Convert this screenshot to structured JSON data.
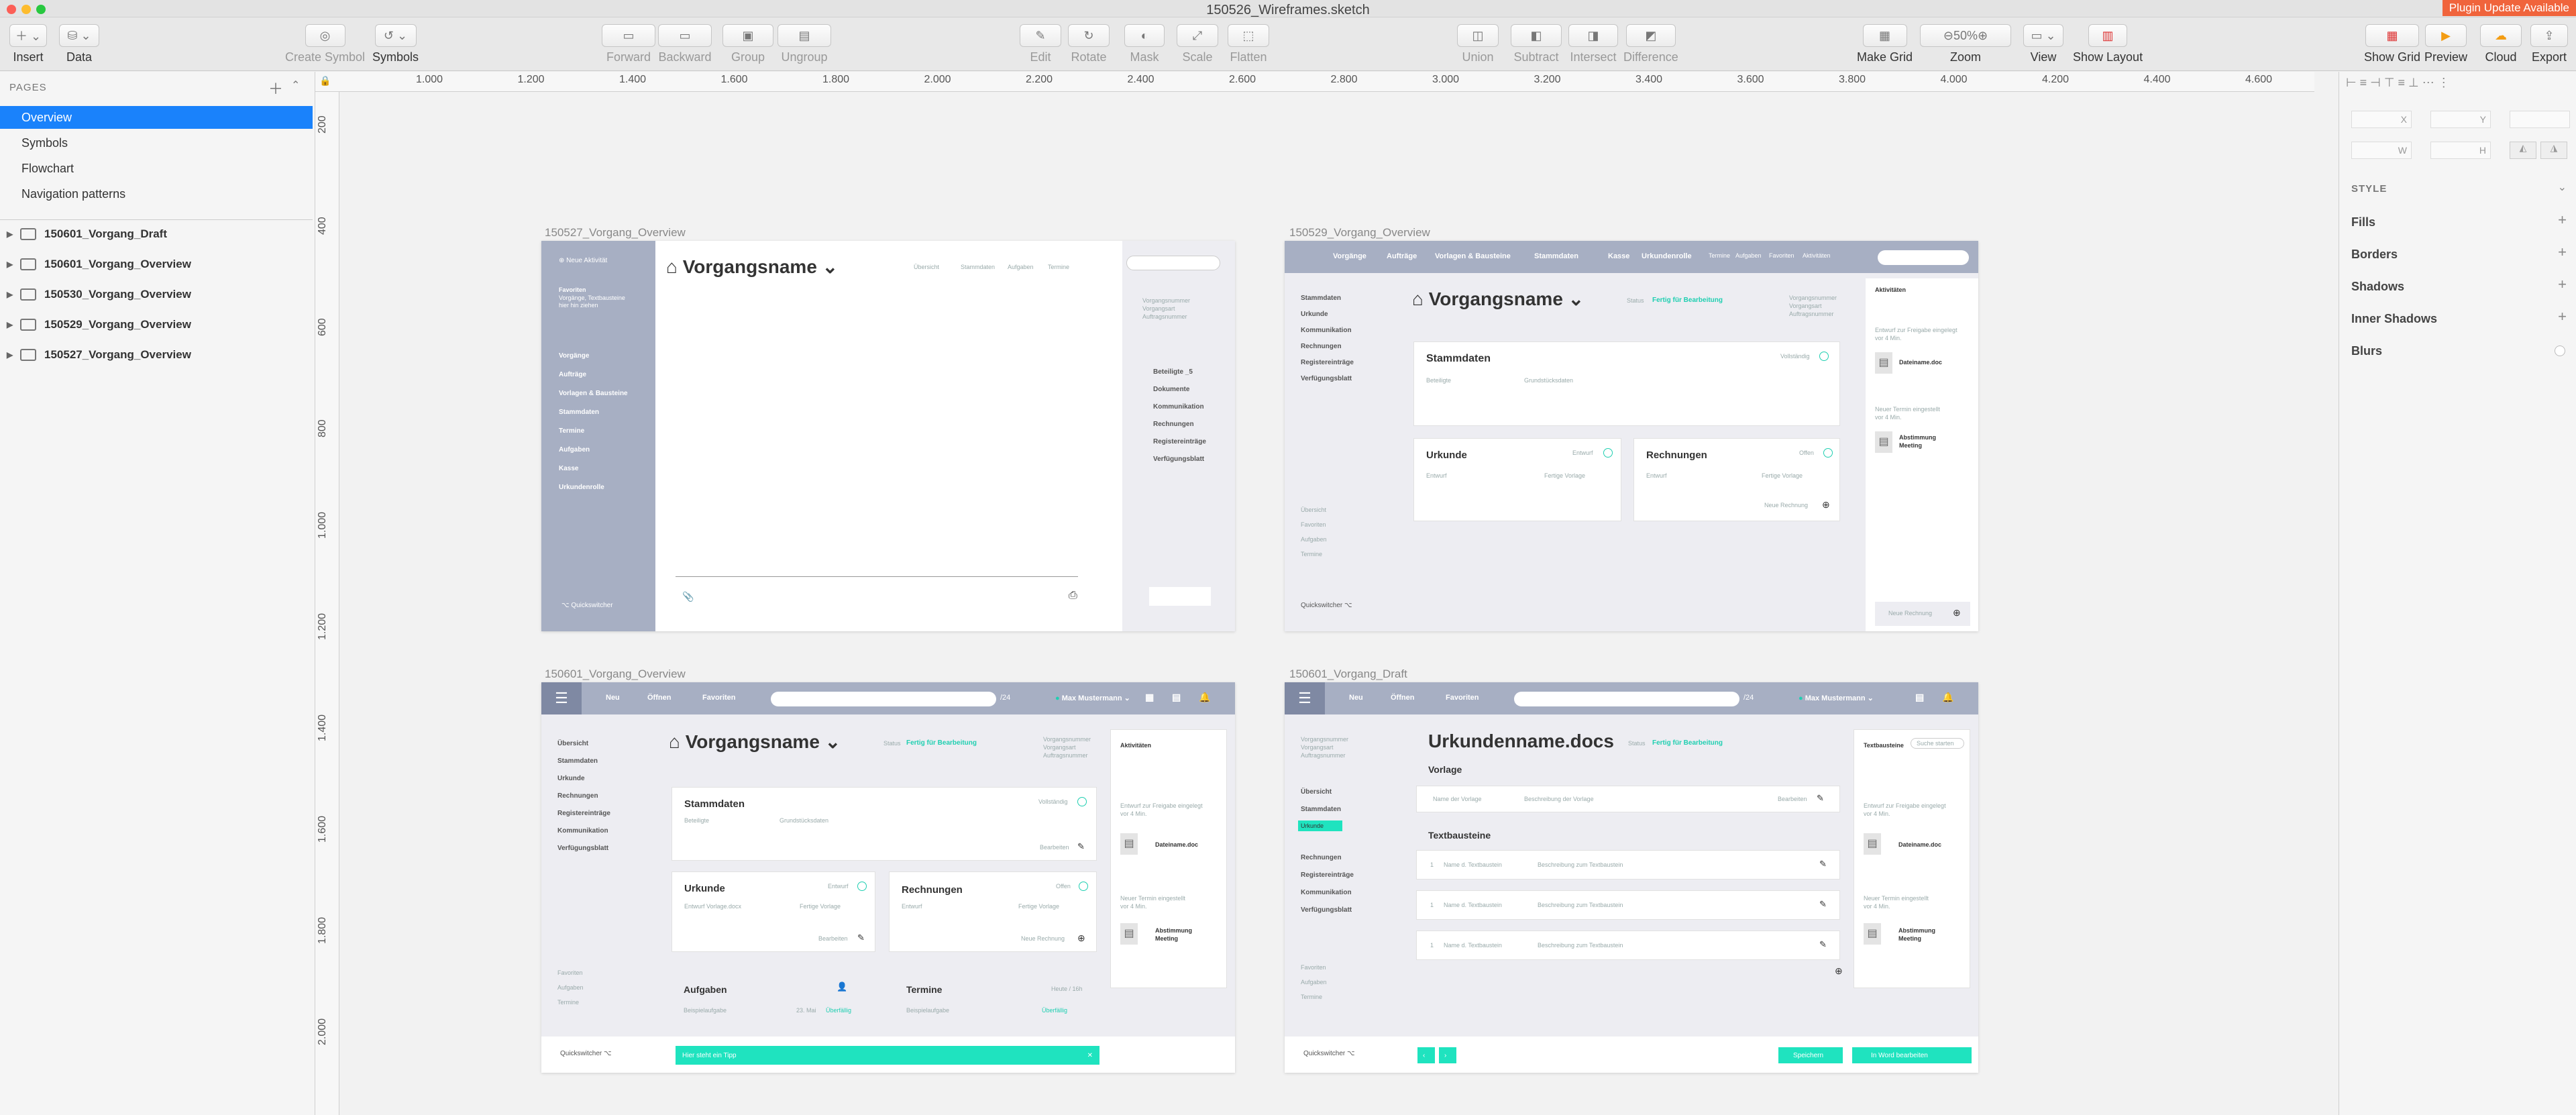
{
  "window": {
    "title": "150526_Wireframes.sketch",
    "plugin_notice": "Plugin Update Available"
  },
  "toolbar": {
    "insert": "Insert",
    "data": "Data",
    "create_symbol": "Create Symbol",
    "symbols": "Symbols",
    "forward": "Forward",
    "backward": "Backward",
    "group": "Group",
    "ungroup": "Ungroup",
    "edit": "Edit",
    "rotate": "Rotate",
    "mask": "Mask",
    "scale": "Scale",
    "flatten": "Flatten",
    "union": "Union",
    "subtract": "Subtract",
    "intersect": "Intersect",
    "difference": "Difference",
    "make_grid": "Make Grid",
    "zoom_label": "Zoom",
    "zoom_value": "50%",
    "view": "View",
    "show_layout": "Show Layout",
    "show_grid": "Show Grid",
    "preview": "Preview",
    "cloud": "Cloud",
    "export": "Export"
  },
  "sidebar": {
    "pages_header": "PAGES",
    "pages": [
      "Overview",
      "Symbols",
      "Flowchart",
      "Navigation patterns"
    ],
    "layers": [
      "150601_Vorgang_Draft",
      "150601_Vorgang_Overview",
      "150530_Vorgang_Overview",
      "150529_Vorgang_Overview",
      "150527_Vorgang_Overview"
    ]
  },
  "ruler": {
    "top": [
      "1.000",
      "1.200",
      "1.400",
      "1.600",
      "1.800",
      "2.000",
      "2.200",
      "2.400",
      "2.600",
      "2.800",
      "3.000",
      "3.200",
      "3.400",
      "3.600",
      "3.800",
      "4.000",
      "4.200",
      "4.400",
      "4.600"
    ],
    "left": [
      "200",
      "400",
      "600",
      "800",
      "1.000",
      "1.200",
      "1.400",
      "1.600",
      "1.800",
      "2.000"
    ]
  },
  "inspector": {
    "x": "X",
    "y": "Y",
    "w": "W",
    "h": "H",
    "style": "STYLE",
    "fills": "Fills",
    "borders": "Borders",
    "shadows": "Shadows",
    "inner_shadows": "Inner Shadows",
    "blurs": "Blurs"
  },
  "artboards": {
    "a1": {
      "label": "150527_Vorgang_Overview",
      "new": "Neue Aktivität",
      "fav": "Favoriten",
      "fav_sub1": "Vorgänge, Textbausteine",
      "fav_sub2": "hier hin ziehen",
      "nav": [
        "Vorgänge",
        "Aufträge",
        "Vorlagen & Bausteine",
        "Stammdaten",
        "Termine",
        "Aufgaben",
        "Kasse",
        "Urkundenrolle"
      ],
      "title": "Vorgangsname",
      "tabs": [
        "Übersicht",
        "Stammdaten",
        "Aufgaben",
        "Termine"
      ],
      "meta": [
        "Vorgangsnummer",
        "Vorgangsart",
        "Auftragsnummer"
      ],
      "right": [
        "Beteiligte _5",
        "Dokumente",
        "Kommunikation",
        "Rechnungen",
        "Registereinträge",
        "Verfügungsblatt"
      ],
      "quick": "Quickswitcher"
    },
    "a2": {
      "label": "150529_Vorgang_Overview",
      "nav": [
        "Vorgänge",
        "Aufträge",
        "Vorlagen & Bausteine",
        "Stammdaten",
        "Kasse",
        "Urkundenrolle",
        "Termine",
        "Aufgaben",
        "Favoriten",
        "Aktivitäten"
      ],
      "left": [
        "Stammdaten",
        "Urkunde",
        "Kommunikation",
        "Rechnungen",
        "Registereinträge",
        "Verfügungsblatt"
      ],
      "leftsub": [
        "Übersicht",
        "Favoriten",
        "Aufgaben",
        "Termine"
      ],
      "title": "Vorgangsname",
      "status_lbl": "Status",
      "status": "Fertig für Bearbeitung",
      "meta": [
        "Vorgangsnummer",
        "Vorgangsart",
        "Auftragsnummer"
      ],
      "stamm": "Stammdaten",
      "complete": "Vollständig",
      "beteiligte": "Beteiligte",
      "grund": "Grundstücksdaten",
      "urkunde": "Urkunde",
      "entwurf": "Entwurf",
      "fertig": "Fertige Vorlage",
      "rechnungen": "Rechnungen",
      "offen": "Offen",
      "neue_rechnung": "Neue Rechnung",
      "akt": "Aktivitäten",
      "akt1": "Entwurf zur Freigabe eingelegt",
      "akt1b": "vor 4 Min.",
      "doc1": "Dateiname.doc",
      "akt2": "Neuer Termin eingestellt",
      "akt2b": "vor 4 Min.",
      "doc2": "Abstimmung",
      "doc2b": "Meeting",
      "quick": "Quickswitcher"
    },
    "a3": {
      "label": "150601_Vorgang_Overview",
      "nav": [
        "Neu",
        "Öffnen",
        "Favoriten"
      ],
      "counter": "/24",
      "user": "Max Mustermann",
      "left": [
        "Übersicht",
        "Stammdaten",
        "Urkunde",
        "Rechnungen",
        "Registereinträge",
        "Kommunikation",
        "Verfügungsblatt"
      ],
      "leftsub": [
        "Favoriten",
        "Aufgaben",
        "Termine"
      ],
      "title": "Vorgangsname",
      "status_lbl": "Status",
      "status": "Fertig für Bearbeitung",
      "meta": [
        "Vorgangsnummer",
        "Vorgangsart",
        "Auftragsnummer"
      ],
      "stamm": "Stammdaten",
      "complete": "Vollständig",
      "beteiligte": "Beteiligte",
      "grund": "Grundstücksdaten",
      "bearbeiten": "Bearbeiten",
      "urkunde": "Urkunde",
      "entwurf": "Entwurf",
      "entwurf_doc": "Entwurf Vorlage.docx",
      "fertig": "Fertige Vorlage",
      "rechnungen": "Rechnungen",
      "offen": "Offen",
      "neue_rechnung": "Neue Rechnung",
      "aufgaben": "Aufgaben",
      "beispiel": "Beispielaufgabe",
      "date": "23. Mai",
      "ueberf": "Überfällig",
      "termine": "Termine",
      "termin_meta": "Heute / 16h",
      "beispiel2": "Beispielaufgabe",
      "akt": "Aktivitäten",
      "akt1": "Entwurf zur Freigabe eingelegt",
      "akt1b": "vor 4 Min.",
      "doc1": "Dateiname.doc",
      "akt2": "Neuer Termin eingestellt",
      "akt2b": "vor 4 Min.",
      "doc2": "Abstimmung",
      "doc2b": "Meeting",
      "quick": "Quickswitcher",
      "tip": "Hier steht ein Tipp"
    },
    "a4": {
      "label": "150601_Vorgang_Draft",
      "nav": [
        "Neu",
        "Öffnen",
        "Favoriten"
      ],
      "counter": "/24",
      "user": "Max Mustermann",
      "left": [
        "Übersicht",
        "Stammdaten",
        "Urkunde",
        "Rechnungen",
        "Registereinträge",
        "Kommunikation",
        "Verfügungsblatt"
      ],
      "leftsub": [
        "Favoriten",
        "Aufgaben",
        "Termine"
      ],
      "title": "Urkundenname.docs",
      "status_lbl": "Status",
      "status": "Fertig für Bearbeitung",
      "meta": [
        "Vorgangsnummer",
        "Vorgangsart",
        "Auftragsnummer"
      ],
      "vorlage": "Vorlage",
      "vorlage_name": "Name der Vorlage",
      "vorlage_desc": "Beschreibung der Vorlage",
      "bearbeiten": "Bearbeiten",
      "textb": "Textbausteine",
      "tb_num": "1",
      "tb_name": "Name d. Textbaustein",
      "tb_desc": "Beschreibung zum Textbaustein",
      "side_h": "Textbausteine",
      "side_search": "Suche starten",
      "akt1": "Entwurf zur Freigabe eingelegt",
      "akt1b": "vor 4 Min.",
      "doc1": "Dateiname.doc",
      "akt2": "Neuer Termin eingestellt",
      "akt2b": "vor 4 Min.",
      "doc2": "Abstimmung",
      "doc2b": "Meeting",
      "quick": "Quickswitcher",
      "speichern": "Speichern",
      "word": "In Word bearbeiten"
    }
  }
}
